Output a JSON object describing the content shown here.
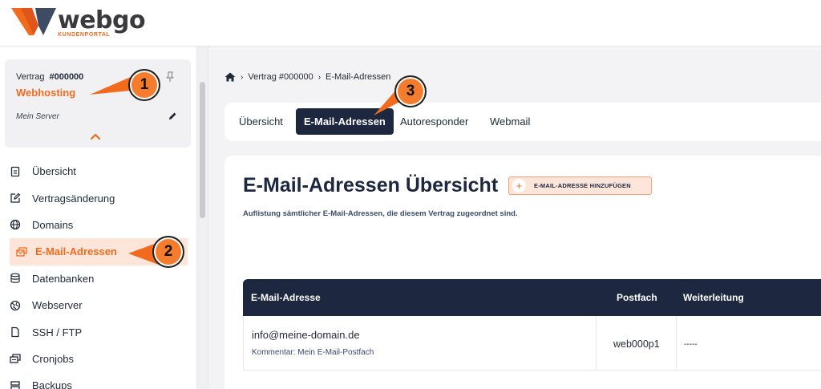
{
  "brand": {
    "name": "webgo",
    "subtitle": "KUNDENPORTAL",
    "accent": "#f26b1d",
    "navy": "#1d2740"
  },
  "contract": {
    "label": "Vertrag",
    "number": "#000000",
    "name": "Webhosting",
    "server": "Mein Server"
  },
  "sidebar": {
    "items": [
      {
        "label": "Übersicht",
        "icon": "document-icon"
      },
      {
        "label": "Vertragsänderung",
        "icon": "edit-square-icon"
      },
      {
        "label": "Domains",
        "icon": "globe-icon"
      },
      {
        "label": "E-Mail-Adressen",
        "icon": "mail-icon",
        "active": true
      },
      {
        "label": "Datenbanken",
        "icon": "database-icon"
      },
      {
        "label": "Webserver",
        "icon": "globe-network-icon"
      },
      {
        "label": "SSH / FTP",
        "icon": "file-icon"
      },
      {
        "label": "Cronjobs",
        "icon": "cron-icon"
      },
      {
        "label": "Backups",
        "icon": "backup-icon"
      }
    ]
  },
  "callouts": [
    "1",
    "2",
    "3"
  ],
  "breadcrumb": {
    "items": [
      "Vertrag #000000",
      "E-Mail-Adressen"
    ]
  },
  "tabs": [
    {
      "label": "Übersicht"
    },
    {
      "label": "E-Mail-Adressen",
      "active": true
    },
    {
      "label": "Autoresponder"
    },
    {
      "label": "Webmail"
    }
  ],
  "main": {
    "title": "E-Mail-Adressen Übersicht",
    "add_button": "E-MAIL-ADRESSE HINZUFÜGEN",
    "subtitle": "Auflistung sämtlicher E-Mail-Adressen, die diesem Vertrag zugeordnet sind."
  },
  "table": {
    "headers": [
      "E-Mail-Adresse",
      "Postfach",
      "Weiterleitung"
    ],
    "rows": [
      {
        "email": "info@meine-domain.de",
        "comment": "Kommentar: Mein E-Mail-Postfach",
        "postfach": "web000p1",
        "weiterleitung": "-----"
      }
    ]
  }
}
